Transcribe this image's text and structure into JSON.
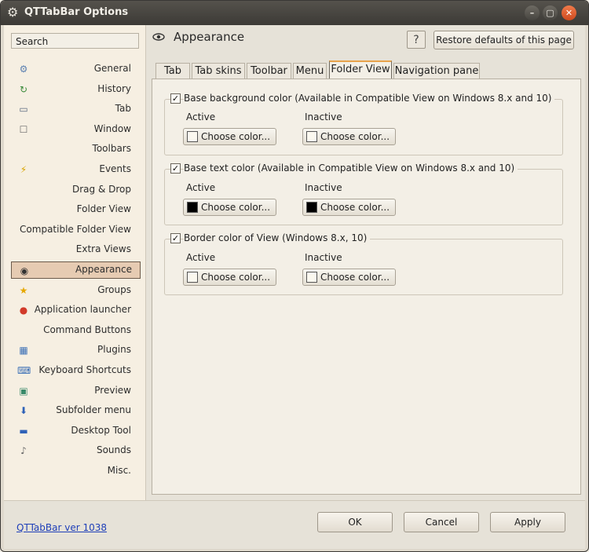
{
  "window": {
    "title": "QTTabBar Options"
  },
  "sidebar": {
    "search_label": "Search",
    "items": [
      {
        "label": "General",
        "icon": "gear-icon"
      },
      {
        "label": "History",
        "icon": "history-icon"
      },
      {
        "label": "Tab",
        "icon": "tab-icon"
      },
      {
        "label": "Window",
        "icon": "window-icon"
      },
      {
        "label": "Toolbars",
        "icon": ""
      },
      {
        "label": "Events",
        "icon": "lightning-icon"
      },
      {
        "label": "Drag & Drop",
        "icon": ""
      },
      {
        "label": "Folder View",
        "icon": ""
      },
      {
        "label": "Compatible Folder View",
        "icon": ""
      },
      {
        "label": "Extra Views",
        "icon": ""
      },
      {
        "label": "Appearance",
        "icon": "eye-icon",
        "selected": true
      },
      {
        "label": "Groups",
        "icon": "star-icon"
      },
      {
        "label": "Application launcher",
        "icon": "launcher-icon"
      },
      {
        "label": "Command Buttons",
        "icon": ""
      },
      {
        "label": "Plugins",
        "icon": "plugin-icon"
      },
      {
        "label": "Keyboard Shortcuts",
        "icon": "keyboard-icon"
      },
      {
        "label": "Preview",
        "icon": "preview-icon"
      },
      {
        "label": "Subfolder menu",
        "icon": "subfolder-icon"
      },
      {
        "label": "Desktop Tool",
        "icon": "desktop-icon"
      },
      {
        "label": "Sounds",
        "icon": "speaker-icon"
      },
      {
        "label": "Misc.",
        "icon": ""
      }
    ]
  },
  "header": {
    "title": "Appearance",
    "help_label": "?",
    "restore_label": "Restore defaults of this page"
  },
  "tabs": [
    {
      "label": "Tab"
    },
    {
      "label": "Tab skins"
    },
    {
      "label": "Toolbar"
    },
    {
      "label": "Menu"
    },
    {
      "label": "Folder View",
      "active": true
    },
    {
      "label": "Navigation pane"
    }
  ],
  "groups": [
    {
      "label": "Base background color (Available in Compatible View on Windows 8.x and 10)",
      "checked": true,
      "active_label": "Active",
      "inactive_label": "Inactive",
      "active_button": "Choose color...",
      "inactive_button": "Choose color...",
      "active_color": "#fbf8ef",
      "inactive_color": "#fbf8ef"
    },
    {
      "label": "Base text color (Available in Compatible View on Windows 8.x and 10)",
      "checked": true,
      "active_label": "Active",
      "inactive_label": "Inactive",
      "active_button": "Choose color...",
      "inactive_button": "Choose color...",
      "active_color": "#000000",
      "inactive_color": "#000000"
    },
    {
      "label": "Border color of View (Windows 8.x, 10)",
      "checked": true,
      "active_label": "Active",
      "inactive_label": "Inactive",
      "active_button": "Choose color...",
      "inactive_button": "Choose color...",
      "active_color": "#fbf8ef",
      "inactive_color": "#fbf8ef"
    }
  ],
  "footer": {
    "version_link": "QTTabBar ver 1038",
    "ok_label": "OK",
    "cancel_label": "Cancel",
    "apply_label": "Apply"
  }
}
